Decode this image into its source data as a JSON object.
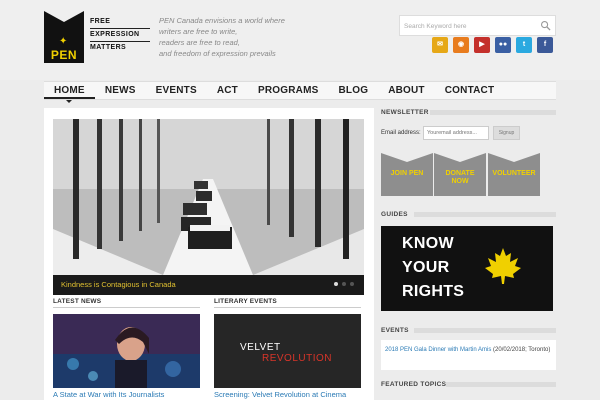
{
  "logo": {
    "mark": "PEN",
    "lines": [
      "FREE",
      "EXPRESSION",
      "MATTERS"
    ]
  },
  "tagline": [
    "PEN Canada envisions a world where",
    "writers are free to write,",
    "readers are free to read,",
    "and freedom of expression prevails"
  ],
  "search": {
    "placeholder": "Search Keyword here"
  },
  "social": [
    {
      "icon": "email-icon",
      "glyph": "✉",
      "color": "#e6a817"
    },
    {
      "icon": "rss-icon",
      "glyph": "◉",
      "color": "#e87c1e"
    },
    {
      "icon": "youtube-icon",
      "glyph": "▶",
      "color": "#c4302b"
    },
    {
      "icon": "flickr-icon",
      "glyph": "●●",
      "color": "#3a5fa3"
    },
    {
      "icon": "twitter-icon",
      "glyph": "t",
      "color": "#2aa9e0"
    },
    {
      "icon": "facebook-icon",
      "glyph": "f",
      "color": "#3b5998"
    }
  ],
  "nav": [
    "HOME",
    "NEWS",
    "EVENTS",
    "ACT",
    "PROGRAMS",
    "BLOG",
    "ABOUT",
    "CONTACT"
  ],
  "slider": {
    "caption": "Kindness is Contagious in Canada",
    "dot_count": 3,
    "active_dot": 0
  },
  "latest_news": {
    "heading": "LATEST NEWS",
    "title": "A State at War with Its Journalists"
  },
  "literary_events": {
    "heading": "LITERARY EVENTS",
    "thumb_line1": "VELVET",
    "thumb_line2": "REVOLUTION",
    "title": "Screening: Velvet Revolution at Cinema"
  },
  "sidebar": {
    "newsletter_heading": "NEWSLETTER",
    "email_label": "Email address:",
    "email_placeholder": "Youremail address...",
    "signup_label": "Signup",
    "cta": [
      {
        "line1": "JOIN PEN",
        "line2": ""
      },
      {
        "line1": "DONATE",
        "line2": "NOW"
      },
      {
        "line1": "VOLUNTEER",
        "line2": ""
      }
    ],
    "guides_heading": "GUIDES",
    "rights_lines": [
      "KNOW",
      "YOUR",
      "RIGHTS"
    ],
    "events_heading": "EVENTS",
    "event_link": "2018 PEN Gala Dinner with Martin Amis",
    "event_meta": " (20/02/2018; Toronto)",
    "featured_heading": "FEATURED TOPICS"
  },
  "colors": {
    "accent_yellow": "#f0d000",
    "link_blue": "#2a7ab5"
  }
}
